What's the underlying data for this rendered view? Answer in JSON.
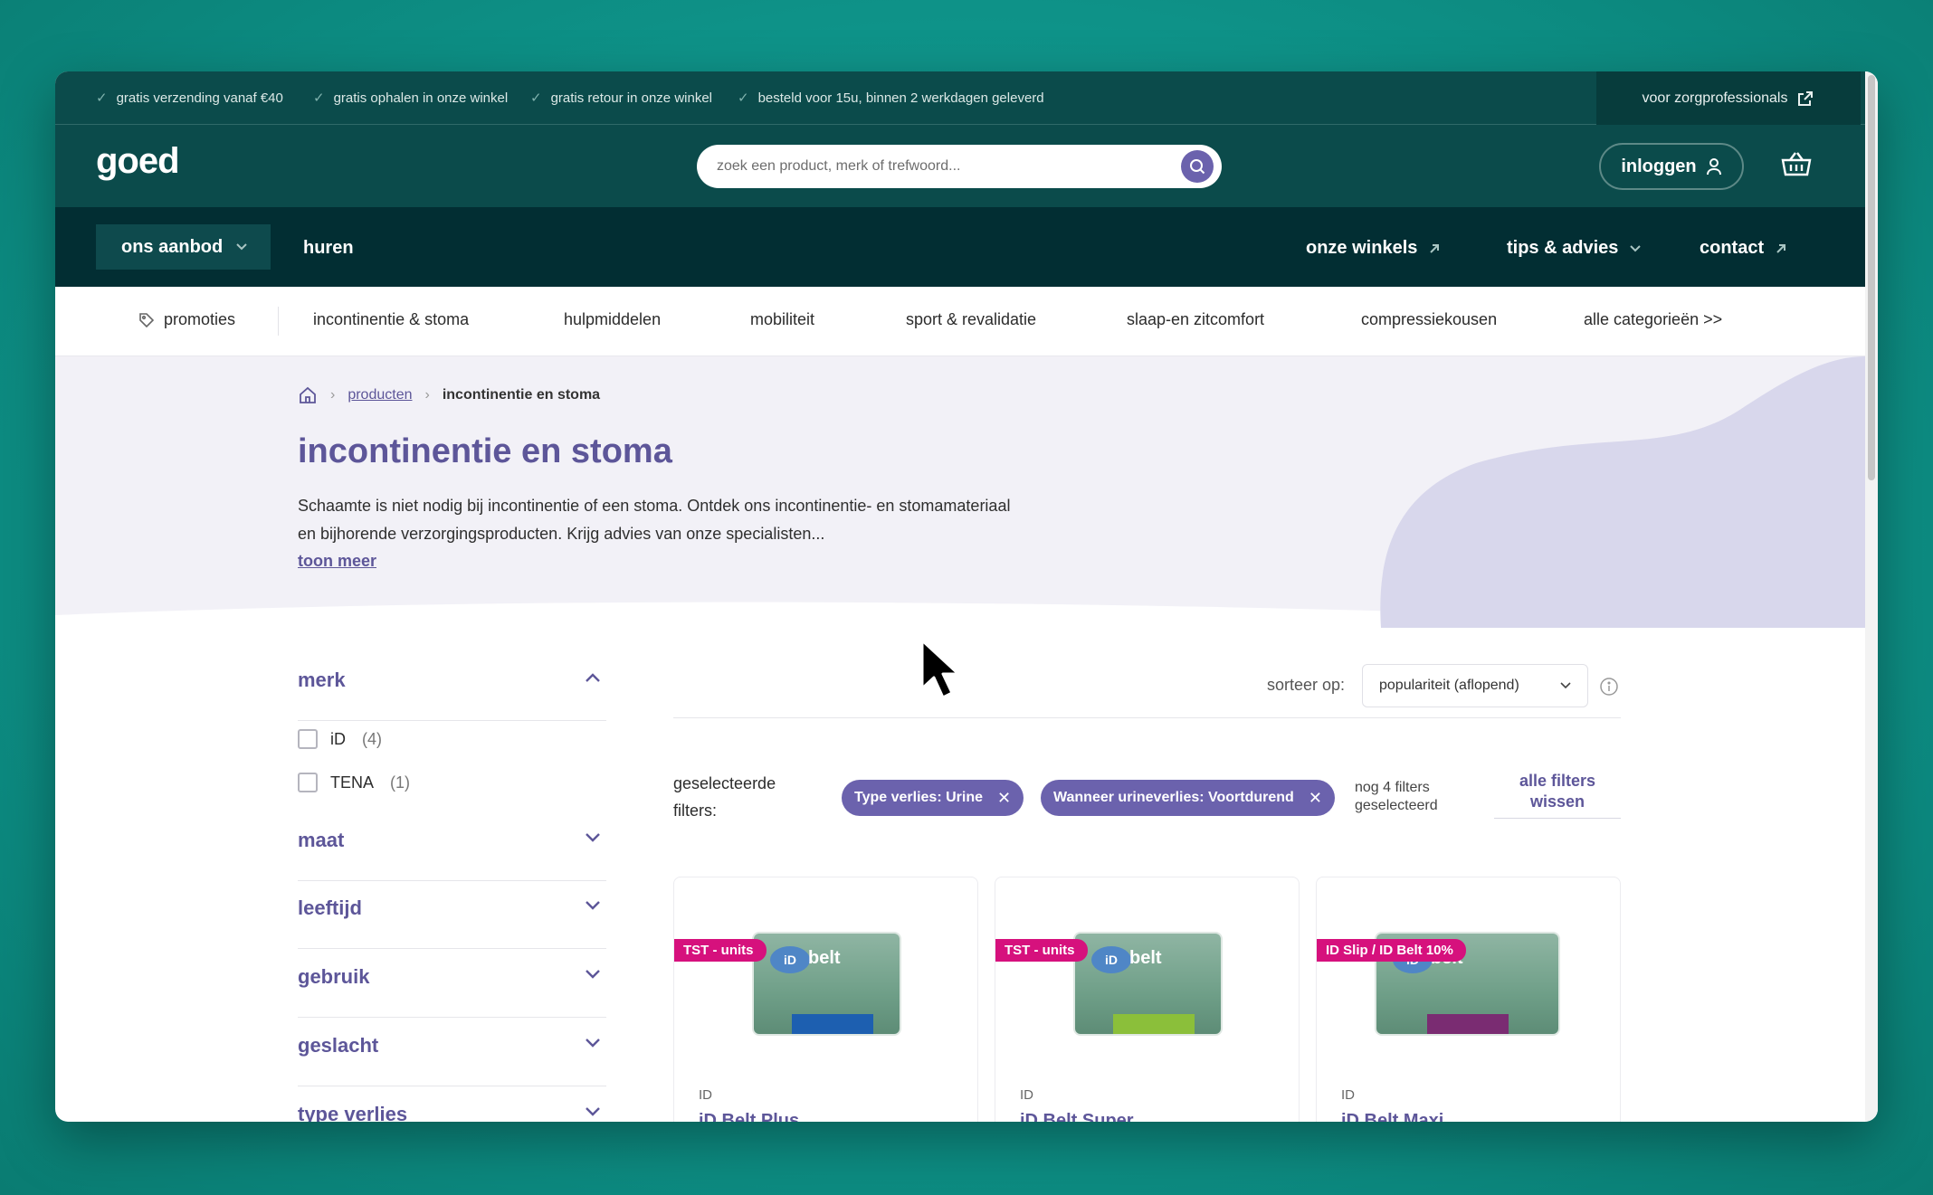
{
  "topbar": {
    "usps": [
      "gratis verzending vanaf €40",
      "gratis ophalen in onze winkel",
      "gratis retour in onze winkel",
      "besteld voor 15u, binnen 2 werkdagen geleverd"
    ],
    "pro_link": "voor zorgprofessionals"
  },
  "header": {
    "logo": "goed",
    "search_placeholder": "zoek een product, merk of trefwoord...",
    "login": "inloggen"
  },
  "mainnav": {
    "aanbod": "ons aanbod",
    "huren": "huren",
    "winkels": "onze winkels",
    "tips": "tips & advies",
    "contact": "contact"
  },
  "categories": [
    "promoties",
    "incontinentie & stoma",
    "hulpmiddelen",
    "mobiliteit",
    "sport & revalidatie",
    "slaap-en zitcomfort",
    "compressiekousen",
    "alle categorieën >>"
  ],
  "breadcrumb": {
    "link": "producten",
    "current": "incontinentie en stoma"
  },
  "hero": {
    "title": "incontinentie en stoma",
    "intro": "Schaamte is niet nodig bij incontinentie of een stoma. Ontdek ons incontinentie- en stomamateriaal en bijhorende verzorgingsproducten. Krijg advies van onze specialisten...",
    "more": "toon meer"
  },
  "filters": {
    "merk": "merk",
    "brands": [
      {
        "label": "iD",
        "count": "(4)"
      },
      {
        "label": "TENA",
        "count": "(1)"
      }
    ],
    "groups": [
      "maat",
      "leeftijd",
      "gebruik",
      "geslacht",
      "type verlies"
    ]
  },
  "sort": {
    "label": "sorteer op:",
    "value": "populariteit (aflopend)"
  },
  "selected": {
    "label": "geselecteerde filters:",
    "chips": [
      "Type verlies: Urine",
      "Wanneer urineverlies: Voortdurend"
    ],
    "more": "nog 4 filters geselecteerd",
    "clear": "alle filters wissen"
  },
  "products": [
    {
      "badge": "TST - units",
      "brand": "ID",
      "name": "iD Belt Plus",
      "band_color": "#1d5fb0"
    },
    {
      "badge": "TST - units",
      "brand": "ID",
      "name": "iD Belt Super",
      "band_color": "#8bbf3a"
    },
    {
      "badge": "ID Slip / ID Belt 10%",
      "brand": "ID",
      "name": "iD Belt Maxi",
      "band_color": "#7a2c72"
    }
  ],
  "product_pack_word": "belt",
  "product_pack_tag": "iD",
  "colors": {
    "dark_teal": "#0b4b4b",
    "nav_dark": "#022e33",
    "purple": "#5d5699",
    "chip": "#6b62ad",
    "badge_pink": "#d6117d"
  }
}
